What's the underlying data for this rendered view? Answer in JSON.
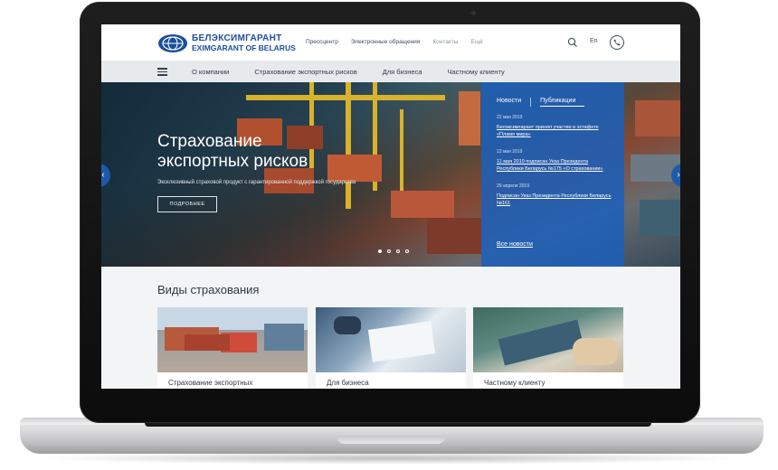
{
  "site": {
    "logo_line1": "БЕЛЭКСИМГАРАНТ",
    "logo_line2": "EXIMGARANT OF BELARUS",
    "brand_color": "#1b4f9c"
  },
  "top_links": [
    "Прессцентр",
    "Электронные обращения",
    "Контакты",
    "Ещё"
  ],
  "top_right": {
    "search_icon": "search-icon",
    "lang": "En",
    "phone_icon": "phone-icon"
  },
  "nav": {
    "menu_icon": "hamburger-icon",
    "items": [
      "О компании",
      "Страхование экспортных рисков",
      "Для бизнеса",
      "Частному клиенту"
    ]
  },
  "hero": {
    "title_line1": "Страхование",
    "title_line2": "экспортных рисков",
    "subtitle": "Эксклюзивный страховой продукт с гарантированной поддержкой государства",
    "button": "ПОДРОБНЕЕ",
    "slides": 4,
    "active_slide": 1,
    "prev_icon": "chevron-left-icon",
    "next_icon": "chevron-right-icon"
  },
  "news_panel": {
    "tabs": [
      "Новости",
      "Публикации"
    ],
    "items": [
      {
        "date": "22 мая 2019",
        "text": "Белэксимгарант принял участие в эстафете «Пламя мира»"
      },
      {
        "date": "13 мая 2019",
        "text": "11 мая 2019 подписан Указ Президента Республики Беларусь №175 «О страховании»"
      },
      {
        "date": "29 апреля 2019",
        "text": "Подписан Указ Президента Республики Беларусь №161"
      }
    ],
    "all_link": "Все новости",
    "panel_color": "#1c60ba"
  },
  "insurance": {
    "title": "Виды страхования",
    "cards": [
      "Страхование экспортных",
      "Для бизнеса",
      "Частному клиенту"
    ]
  }
}
